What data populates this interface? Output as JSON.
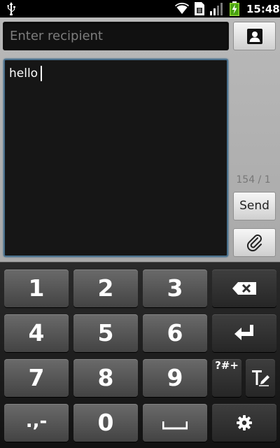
{
  "status_bar": {
    "time": "15:48",
    "icons": [
      "usb-icon",
      "wifi-icon",
      "sim-card-icon",
      "signal-icon",
      "battery-charging-icon"
    ]
  },
  "compose": {
    "recipient_placeholder": "Enter recipient",
    "message_text": "hello",
    "char_counter": "154 / 1",
    "send_label": "Send",
    "contact_icon": "contact-icon",
    "attach_icon": "paperclip-icon"
  },
  "keyboard": {
    "rows": [
      [
        "1",
        "2",
        "3"
      ],
      [
        "4",
        "5",
        "6"
      ],
      [
        "7",
        "8",
        "9"
      ],
      [
        ".,-",
        "0"
      ]
    ],
    "symbols_label": "?#+",
    "fn_icons": [
      "backspace-icon",
      "enter-icon",
      "text-mode-icon",
      "settings-icon",
      "space-icon"
    ]
  },
  "colors": {
    "compose_bg": "#b0b0b0",
    "field_bg": "#111111",
    "focus_border": "#4a708c",
    "key_bg": "#555555",
    "fn_key_bg": "#333333"
  }
}
